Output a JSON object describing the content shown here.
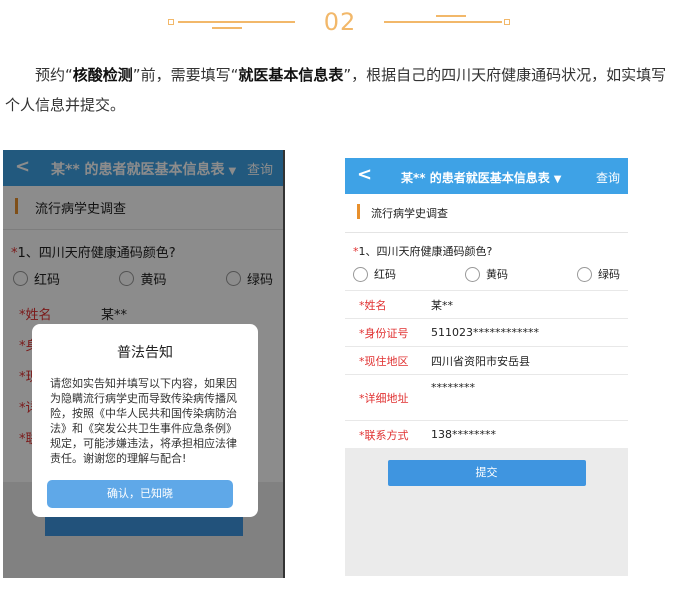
{
  "step": {
    "number": "02"
  },
  "intro": {
    "p1_a": "预约“",
    "p1_b": "核酸检测",
    "p1_c": "”前，需要填写“",
    "p1_d": "就医基本信息表",
    "p1_e": "”，根据自己的四川天府健康通码状况，如实填写个人信息并提交。"
  },
  "left_phone": {
    "back": "<",
    "title": "某** 的患者就医基本信息表",
    "title_caret": "▼",
    "query": "查询",
    "section": "流行病学史调查",
    "question_req": "*",
    "question": "1、四川天府健康通码颜色?",
    "options": [
      "红码",
      "黄码",
      "绿码"
    ],
    "rows": [
      {
        "label": "*姓名",
        "value": "某**"
      },
      {
        "label": "*身",
        "value": ""
      },
      {
        "label": "*现",
        "value": ""
      },
      {
        "label": "*详",
        "value": ""
      },
      {
        "label": "*联",
        "value": ""
      }
    ],
    "dialog": {
      "title": "普法告知",
      "body": "请您如实告知并填写以下内容，如果因为隐瞒流行病学史而导致传染病传播风险，按照《中华人民共和国传染病防治法》和《突发公共卫生事件应急条例》规定，可能涉嫌违法，将承担相应法律责任。谢谢您的理解与配合!",
      "button": "确认，已知晓"
    }
  },
  "right_phone": {
    "back": "<",
    "title": "某** 的患者就医基本信息表",
    "title_caret": "▼",
    "query": "查询",
    "section": "流行病学史调查",
    "question_req": "*",
    "question": "1、四川天府健康通码颜色?",
    "options": [
      "红码",
      "黄码",
      "绿码"
    ],
    "rows": [
      {
        "label": "*姓名",
        "value": "某**"
      },
      {
        "label": "*身份证号",
        "value": "511023************"
      },
      {
        "label": "*现住地区",
        "value": "四川省资阳市安岳县"
      },
      {
        "label": "*详细地址",
        "value": "********"
      },
      {
        "label": "*联系方式",
        "value": "138********"
      }
    ],
    "submit": "提交"
  },
  "colors": {
    "accent": "#3ea2e6",
    "orange": "#e8902d",
    "step_gold": "#f2b86a"
  }
}
